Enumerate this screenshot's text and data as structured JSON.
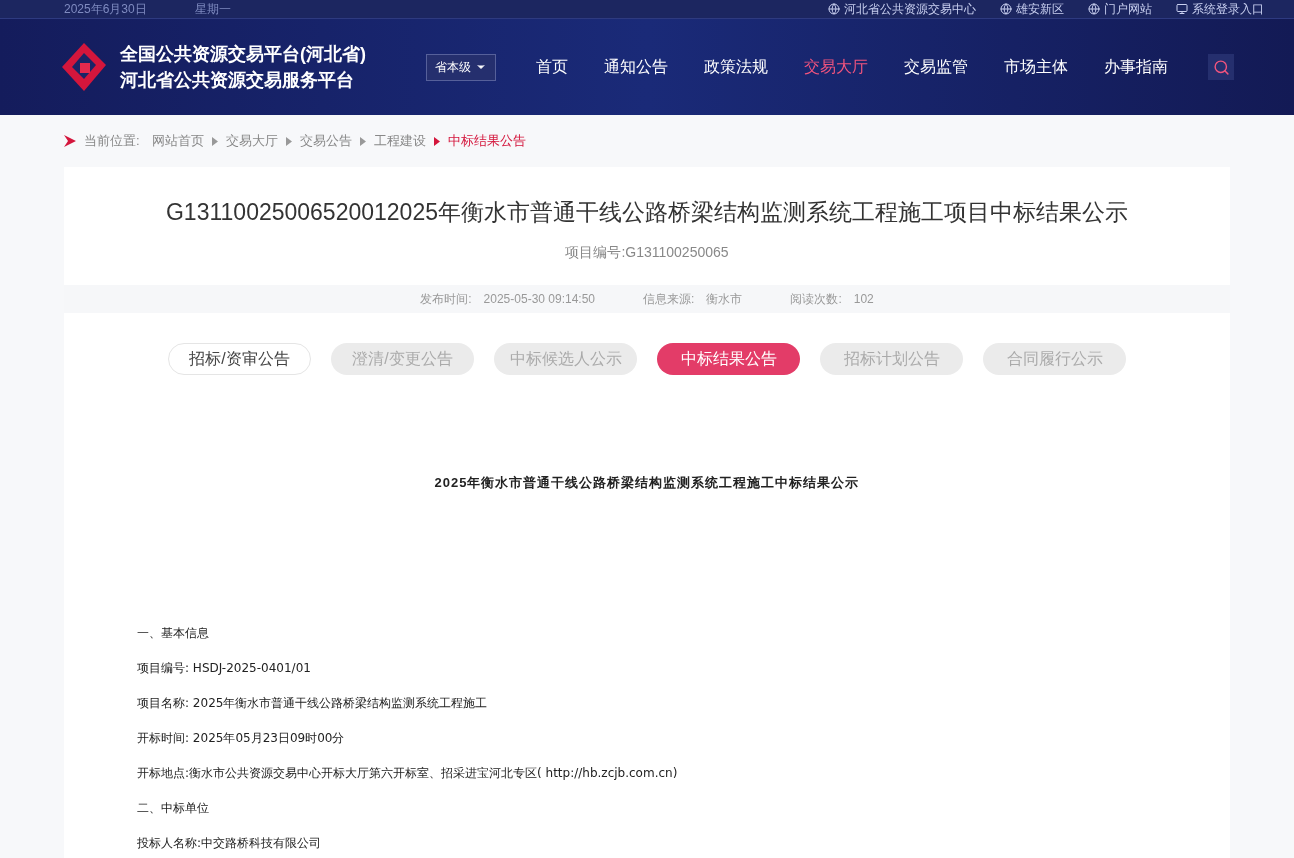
{
  "top_bar": {
    "date": "2025年6月30日",
    "weekday": "星期一",
    "links": [
      {
        "label": "河北省公共资源交易中心",
        "kind": "globe"
      },
      {
        "label": "雄安新区",
        "kind": "globe"
      },
      {
        "label": "门户网站",
        "kind": "globe"
      },
      {
        "label": "系统登录入口",
        "kind": "monitor"
      }
    ]
  },
  "header": {
    "title_line1": "全国公共资源交易平台(河北省)",
    "title_line2": "河北省公共资源交易服务平台",
    "level_select": "省本级",
    "nav": [
      {
        "label": "首页",
        "selected": false
      },
      {
        "label": "通知公告",
        "selected": false
      },
      {
        "label": "政策法规",
        "selected": false
      },
      {
        "label": "交易大厅",
        "selected": true
      },
      {
        "label": "交易监管",
        "selected": false
      },
      {
        "label": "市场主体",
        "selected": false
      },
      {
        "label": "办事指南",
        "selected": false
      }
    ]
  },
  "breadcrumb": {
    "label": "当前位置:",
    "items": [
      {
        "label": "网站首页",
        "selected": false
      },
      {
        "label": "交易大厅",
        "selected": false
      },
      {
        "label": "交易公告",
        "selected": false
      },
      {
        "label": "工程建设",
        "selected": false
      },
      {
        "label": "中标结果公告",
        "selected": true
      }
    ]
  },
  "article": {
    "title": "G13110025006520012025年衡水市普通干线公路桥梁结构监测系统工程施工项目中标结果公示",
    "project_no": "项目编号:G131100250065",
    "meta": [
      {
        "label": "发布时间:",
        "value": "2025-05-30 09:14:50"
      },
      {
        "label": "信息来源:",
        "value": "衡水市"
      },
      {
        "label": "阅读次数:",
        "value": "102"
      }
    ],
    "tabs": [
      {
        "label": "招标/资审公告",
        "selected": false,
        "disabled": false
      },
      {
        "label": "澄清/变更公告",
        "selected": false,
        "disabled": true
      },
      {
        "label": "中标候选人公示",
        "selected": false,
        "disabled": true
      },
      {
        "label": "中标结果公告",
        "selected": true,
        "disabled": false
      },
      {
        "label": "招标计划公告",
        "selected": false,
        "disabled": true
      },
      {
        "label": "合同履行公示",
        "selected": false,
        "disabled": true
      }
    ],
    "doc_title": "2025年衡水市普通干线公路桥梁结构监测系统工程施工中标结果公示",
    "lines": [
      "一、基本信息",
      "项目编号: HSDJ-2025-0401/01",
      "项目名称: 2025年衡水市普通干线公路桥梁结构监测系统工程施工",
      "开标时间: 2025年05月23日09时00分",
      "开标地点:衡水市公共资源交易中心开标大厅第六开标室、招采进宝河北专区( http://hb.zcjb.com.cn)",
      "二、中标单位",
      "投标人名称:中交路桥科技有限公司"
    ]
  }
}
